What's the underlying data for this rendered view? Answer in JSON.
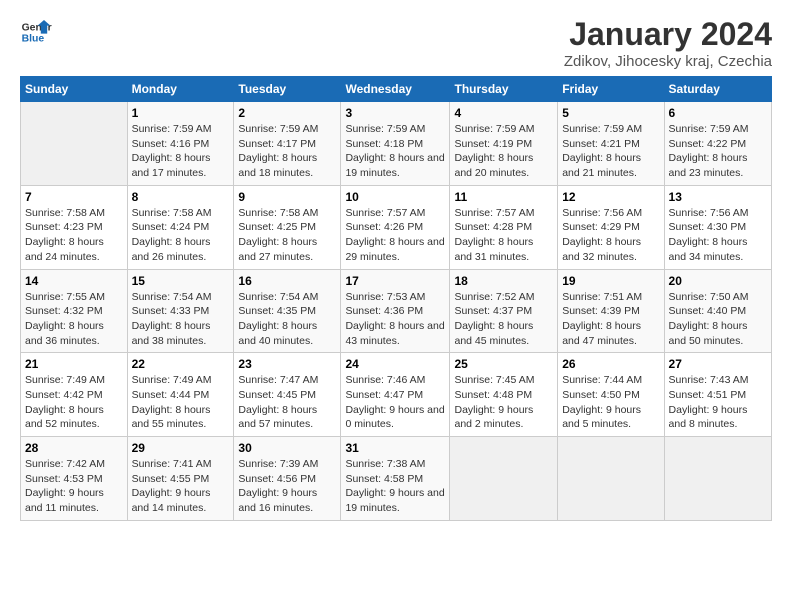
{
  "header": {
    "logo_line1": "General",
    "logo_line2": "Blue",
    "title": "January 2024",
    "subtitle": "Zdikov, Jihocesky kraj, Czechia"
  },
  "days_of_week": [
    "Sunday",
    "Monday",
    "Tuesday",
    "Wednesday",
    "Thursday",
    "Friday",
    "Saturday"
  ],
  "weeks": [
    [
      {
        "num": "",
        "empty": true
      },
      {
        "num": "1",
        "sunrise": "7:59 AM",
        "sunset": "4:16 PM",
        "daylight": "8 hours and 17 minutes."
      },
      {
        "num": "2",
        "sunrise": "7:59 AM",
        "sunset": "4:17 PM",
        "daylight": "8 hours and 18 minutes."
      },
      {
        "num": "3",
        "sunrise": "7:59 AM",
        "sunset": "4:18 PM",
        "daylight": "8 hours and 19 minutes."
      },
      {
        "num": "4",
        "sunrise": "7:59 AM",
        "sunset": "4:19 PM",
        "daylight": "8 hours and 20 minutes."
      },
      {
        "num": "5",
        "sunrise": "7:59 AM",
        "sunset": "4:21 PM",
        "daylight": "8 hours and 21 minutes."
      },
      {
        "num": "6",
        "sunrise": "7:59 AM",
        "sunset": "4:22 PM",
        "daylight": "8 hours and 23 minutes."
      }
    ],
    [
      {
        "num": "7",
        "sunrise": "7:58 AM",
        "sunset": "4:23 PM",
        "daylight": "8 hours and 24 minutes."
      },
      {
        "num": "8",
        "sunrise": "7:58 AM",
        "sunset": "4:24 PM",
        "daylight": "8 hours and 26 minutes."
      },
      {
        "num": "9",
        "sunrise": "7:58 AM",
        "sunset": "4:25 PM",
        "daylight": "8 hours and 27 minutes."
      },
      {
        "num": "10",
        "sunrise": "7:57 AM",
        "sunset": "4:26 PM",
        "daylight": "8 hours and 29 minutes."
      },
      {
        "num": "11",
        "sunrise": "7:57 AM",
        "sunset": "4:28 PM",
        "daylight": "8 hours and 31 minutes."
      },
      {
        "num": "12",
        "sunrise": "7:56 AM",
        "sunset": "4:29 PM",
        "daylight": "8 hours and 32 minutes."
      },
      {
        "num": "13",
        "sunrise": "7:56 AM",
        "sunset": "4:30 PM",
        "daylight": "8 hours and 34 minutes."
      }
    ],
    [
      {
        "num": "14",
        "sunrise": "7:55 AM",
        "sunset": "4:32 PM",
        "daylight": "8 hours and 36 minutes."
      },
      {
        "num": "15",
        "sunrise": "7:54 AM",
        "sunset": "4:33 PM",
        "daylight": "8 hours and 38 minutes."
      },
      {
        "num": "16",
        "sunrise": "7:54 AM",
        "sunset": "4:35 PM",
        "daylight": "8 hours and 40 minutes."
      },
      {
        "num": "17",
        "sunrise": "7:53 AM",
        "sunset": "4:36 PM",
        "daylight": "8 hours and 43 minutes."
      },
      {
        "num": "18",
        "sunrise": "7:52 AM",
        "sunset": "4:37 PM",
        "daylight": "8 hours and 45 minutes."
      },
      {
        "num": "19",
        "sunrise": "7:51 AM",
        "sunset": "4:39 PM",
        "daylight": "8 hours and 47 minutes."
      },
      {
        "num": "20",
        "sunrise": "7:50 AM",
        "sunset": "4:40 PM",
        "daylight": "8 hours and 50 minutes."
      }
    ],
    [
      {
        "num": "21",
        "sunrise": "7:49 AM",
        "sunset": "4:42 PM",
        "daylight": "8 hours and 52 minutes."
      },
      {
        "num": "22",
        "sunrise": "7:49 AM",
        "sunset": "4:44 PM",
        "daylight": "8 hours and 55 minutes."
      },
      {
        "num": "23",
        "sunrise": "7:47 AM",
        "sunset": "4:45 PM",
        "daylight": "8 hours and 57 minutes."
      },
      {
        "num": "24",
        "sunrise": "7:46 AM",
        "sunset": "4:47 PM",
        "daylight": "9 hours and 0 minutes."
      },
      {
        "num": "25",
        "sunrise": "7:45 AM",
        "sunset": "4:48 PM",
        "daylight": "9 hours and 2 minutes."
      },
      {
        "num": "26",
        "sunrise": "7:44 AM",
        "sunset": "4:50 PM",
        "daylight": "9 hours and 5 minutes."
      },
      {
        "num": "27",
        "sunrise": "7:43 AM",
        "sunset": "4:51 PM",
        "daylight": "9 hours and 8 minutes."
      }
    ],
    [
      {
        "num": "28",
        "sunrise": "7:42 AM",
        "sunset": "4:53 PM",
        "daylight": "9 hours and 11 minutes."
      },
      {
        "num": "29",
        "sunrise": "7:41 AM",
        "sunset": "4:55 PM",
        "daylight": "9 hours and 14 minutes."
      },
      {
        "num": "30",
        "sunrise": "7:39 AM",
        "sunset": "4:56 PM",
        "daylight": "9 hours and 16 minutes."
      },
      {
        "num": "31",
        "sunrise": "7:38 AM",
        "sunset": "4:58 PM",
        "daylight": "9 hours and 19 minutes."
      },
      {
        "num": "",
        "empty": true
      },
      {
        "num": "",
        "empty": true
      },
      {
        "num": "",
        "empty": true
      }
    ]
  ]
}
